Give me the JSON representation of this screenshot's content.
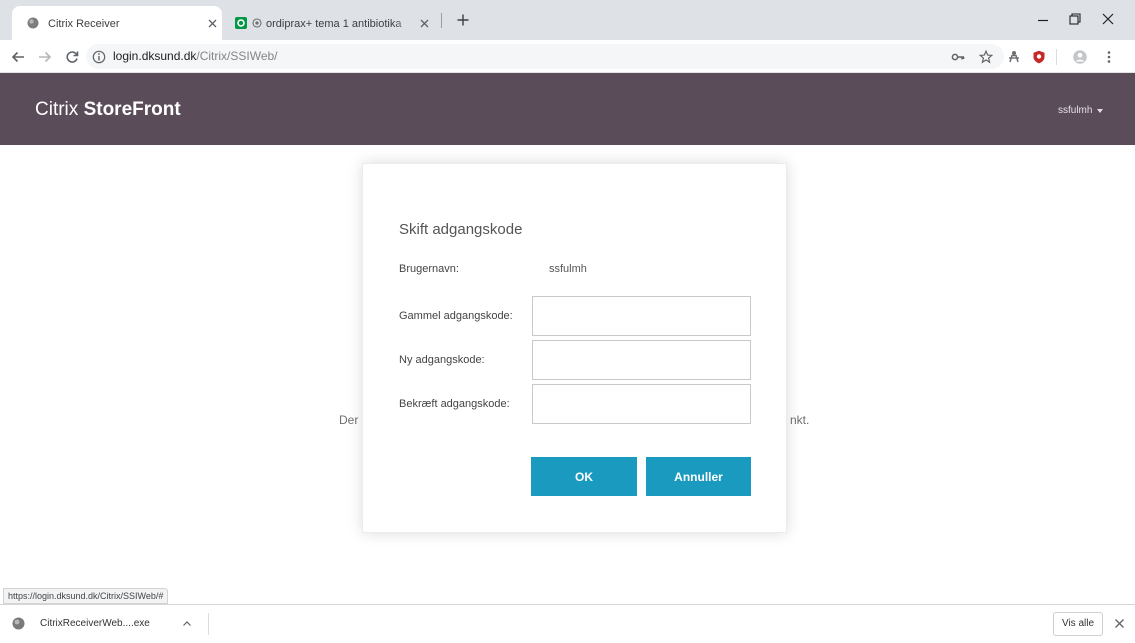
{
  "browser": {
    "tabs": [
      {
        "title": "Citrix Receiver",
        "icon": "citrix-favicon-icon",
        "active": true
      },
      {
        "title": "ordiprax+ tema 1 antibiotika",
        "icon": "qlik-favicon-icon",
        "active": false
      }
    ],
    "address": {
      "host": "login.dksund.dk",
      "path": "/Citrix/SSIWeb/"
    },
    "toolbar_icons": [
      "back-arrow-icon",
      "forward-arrow-icon",
      "reload-icon",
      "info-icon",
      "key-icon",
      "star-icon",
      "extension-icon",
      "shield-extension-icon",
      "profile-avatar-icon",
      "menu-dots-icon"
    ]
  },
  "header": {
    "brand_light": "Citrix ",
    "brand_bold": "StoreFront",
    "user": "ssfulmh"
  },
  "page": {
    "background_text_left": "Der",
    "background_text_right": "nkt."
  },
  "dialog": {
    "title": "Skift adgangskode",
    "username_label": "Brugernavn:",
    "username_value": "ssfulmh",
    "fields": [
      {
        "label": "Gammel adgangskode:",
        "value": "",
        "placeholder": ""
      },
      {
        "label": "Ny adgangskode:",
        "value": "",
        "placeholder": ""
      },
      {
        "label": "Bekræft adgangskode:",
        "value": "",
        "placeholder": ""
      }
    ],
    "ok_label": "OK",
    "cancel_label": "Annuller"
  },
  "status_url": "https://login.dksund.dk/Citrix/SSIWeb/#",
  "downloads": {
    "file": "CitrixReceiverWeb....exe",
    "show_all": "Vis alle"
  },
  "colors": {
    "header_bg": "#5b4c5a",
    "button_bg": "#1b9ac0",
    "tabstrip_bg": "#dee1e6",
    "shield_red": "#c62828",
    "qlik_green": "#009845"
  }
}
